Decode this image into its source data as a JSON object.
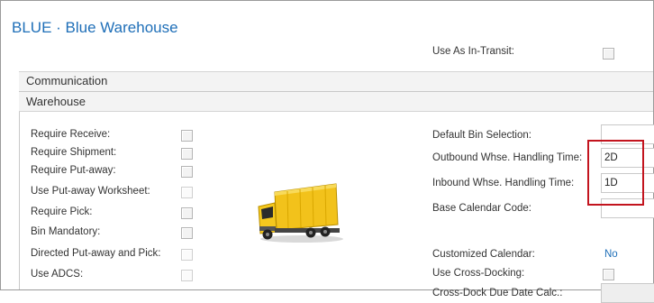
{
  "page": {
    "title": "BLUE · Blue Warehouse"
  },
  "top_field": {
    "label": "Use As In-Transit:",
    "checked": false
  },
  "sections": {
    "communication": "Communication",
    "warehouse": "Warehouse"
  },
  "left_fields": [
    {
      "label": "Require Receive:",
      "checked": false
    },
    {
      "label": "Require Shipment:",
      "checked": false
    },
    {
      "label": "Require Put-away:",
      "checked": false
    },
    {
      "label": "Use Put-away Worksheet:",
      "checked": false
    },
    {
      "label": "Require Pick:",
      "checked": false
    },
    {
      "label": "Bin Mandatory:",
      "checked": false
    },
    {
      "label": "Directed Put-away and Pick:",
      "checked": false
    },
    {
      "label": "Use ADCS:",
      "checked": false
    }
  ],
  "right_fields": {
    "default_bin_selection": {
      "label": "Default Bin Selection:",
      "value": ""
    },
    "outbound_handling": {
      "label": "Outbound Whse. Handling Time:",
      "value": "2D"
    },
    "inbound_handling": {
      "label": "Inbound Whse. Handling Time:",
      "value": "1D"
    },
    "base_calendar": {
      "label": "Base Calendar Code:",
      "value": ""
    },
    "customized_calendar": {
      "label": "Customized Calendar:",
      "value": "No"
    },
    "use_cross_docking": {
      "label": "Use Cross-Docking:",
      "checked": false
    },
    "cross_dock_calc": {
      "label": "Cross-Dock Due Date Calc.:",
      "value": ""
    }
  },
  "colors": {
    "accent": "#1f6fb8",
    "highlight": "#c3141e",
    "truck_body": "#f2c21b"
  },
  "icons": {
    "truck": "truck-icon"
  }
}
